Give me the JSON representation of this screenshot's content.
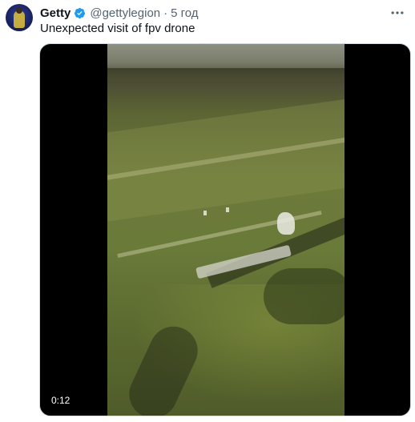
{
  "author": {
    "name": "Getty",
    "handle": "@gettylegion",
    "separator": "·",
    "time": "5 год"
  },
  "tweet": {
    "text": "Unexpected visit of fpv drone"
  },
  "media": {
    "duration": "0:12"
  },
  "icons": {
    "verified": "verified-badge-icon",
    "more": "more-options-icon"
  },
  "colors": {
    "verified": "#1d9bf0",
    "secondary_text": "#536471",
    "primary_text": "#0f1419"
  }
}
